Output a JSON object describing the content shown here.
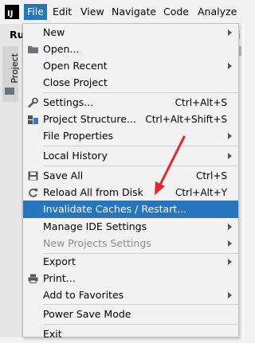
{
  "menubar": {
    "logo_text": "IJ",
    "items": [
      {
        "label": "File",
        "mnemonic": "F"
      },
      {
        "label": "Edit",
        "mnemonic": "E"
      },
      {
        "label": "View",
        "mnemonic": "V"
      },
      {
        "label": "Navigate",
        "mnemonic": "N"
      },
      {
        "label": "Code",
        "mnemonic": "C"
      },
      {
        "label": "Analyze",
        "mnemonic": "z"
      }
    ],
    "active": "File"
  },
  "background": {
    "run_label": "Ru",
    "project_tab_label": "Project",
    "right_fragment": "j",
    "right_marker": "t"
  },
  "file_menu": [
    {
      "label": "New",
      "shortcut": "",
      "submenu": true
    },
    {
      "label": "Open...",
      "shortcut": "",
      "submenu": false,
      "icon": "folder-icon"
    },
    {
      "label": "Open Recent",
      "shortcut": "",
      "submenu": true
    },
    {
      "label": "Close Project",
      "shortcut": "",
      "submenu": false
    },
    {
      "label": "Settings...",
      "shortcut": "Ctrl+Alt+S",
      "submenu": false,
      "icon": "wrench-icon"
    },
    {
      "label": "Project Structure...",
      "shortcut": "Ctrl+Alt+Shift+S",
      "submenu": false,
      "icon": "project-structure-icon"
    },
    {
      "label": "File Properties",
      "shortcut": "",
      "submenu": true
    },
    {
      "label": "Local History",
      "shortcut": "",
      "submenu": true
    },
    {
      "label": "Save All",
      "shortcut": "Ctrl+S",
      "submenu": false,
      "icon": "floppy-disk-icon"
    },
    {
      "label": "Reload All from Disk",
      "shortcut": "Ctrl+Alt+Y",
      "submenu": false,
      "icon": "reload-icon"
    },
    {
      "label": "Invalidate Caches / Restart...",
      "shortcut": "",
      "submenu": false,
      "highlighted": true
    },
    {
      "label": "Manage IDE Settings",
      "shortcut": "",
      "submenu": true
    },
    {
      "label": "New Projects Settings",
      "shortcut": "",
      "submenu": true,
      "disabled": true
    },
    {
      "label": "Export",
      "shortcut": "",
      "submenu": true
    },
    {
      "label": "Print...",
      "shortcut": "",
      "submenu": false,
      "icon": "printer-icon"
    },
    {
      "label": "Add to Favorites",
      "shortcut": "",
      "submenu": true
    },
    {
      "label": "Power Save Mode",
      "shortcut": "",
      "submenu": false
    },
    {
      "label": "Exit",
      "shortcut": "",
      "submenu": false
    }
  ],
  "colors": {
    "highlight": "#2675bf",
    "annotation_arrow": "#e8262a",
    "menu_bg": "#f2f2f2",
    "disabled_text": "#8c8c8c"
  }
}
